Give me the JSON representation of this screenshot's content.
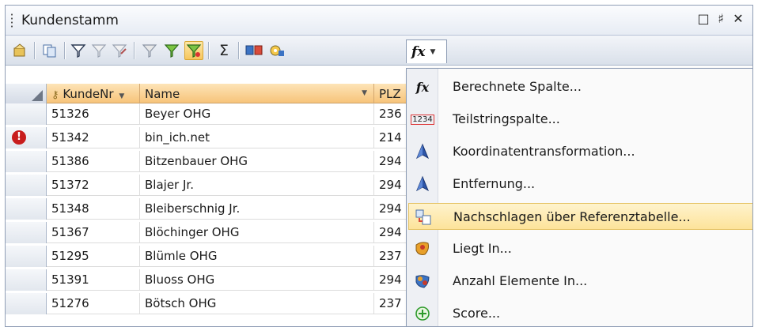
{
  "window": {
    "title": "Kundenstamm",
    "controls": {
      "pin": "□",
      "float": "♯",
      "close": "✕"
    }
  },
  "toolbar": {
    "fx_label": "fx",
    "buttons": [
      "properties-icon",
      "copy-icon",
      "filter-icon",
      "filter-clear-icon",
      "filter-edit-icon",
      "filter-remove-icon",
      "filter-add-icon",
      "filter-active-icon",
      "sum-icon",
      "table-icon",
      "settings-icon"
    ]
  },
  "grid": {
    "columns": [
      {
        "label": "KundeNr"
      },
      {
        "label": "Name"
      },
      {
        "label": "PLZ"
      }
    ],
    "rows": [
      {
        "kundenr": "51326",
        "name": "Beyer OHG",
        "plz": "236",
        "error": false
      },
      {
        "kundenr": "51342",
        "name": "bin_ich.net",
        "plz": "214",
        "error": true
      },
      {
        "kundenr": "51386",
        "name": "Bitzenbauer OHG",
        "plz": "294",
        "error": false
      },
      {
        "kundenr": "51372",
        "name": "Blajer Jr.",
        "plz": "294",
        "error": false
      },
      {
        "kundenr": "51348",
        "name": "Bleiberschnig Jr.",
        "plz": "294",
        "error": false
      },
      {
        "kundenr": "51367",
        "name": "Blöchinger OHG",
        "plz": "294",
        "error": false
      },
      {
        "kundenr": "51295",
        "name": "Blümle OHG",
        "plz": "237",
        "error": false
      },
      {
        "kundenr": "51391",
        "name": "Bluoss OHG",
        "plz": "294",
        "error": false
      },
      {
        "kundenr": "51276",
        "name": "Bötsch OHG",
        "plz": "237",
        "error": false
      }
    ],
    "error_glyph": "!"
  },
  "menu": {
    "items": [
      {
        "label": "Berechnete Spalte...",
        "icon": "fx-icon"
      },
      {
        "label": "Teilstringspalte...",
        "icon": "substring-icon",
        "icon_text": "1234"
      },
      {
        "label": "Koordinatentransformation...",
        "icon": "triangle-icon"
      },
      {
        "label": "Entfernung...",
        "icon": "triangle-icon"
      },
      {
        "label": "Nachschlagen über Referenztabelle...",
        "icon": "lookup-icon"
      },
      {
        "label": "Liegt In...",
        "icon": "map-region-icon"
      },
      {
        "label": "Anzahl Elemente In...",
        "icon": "map-count-icon"
      },
      {
        "label": "Score...",
        "icon": "score-icon"
      }
    ],
    "highlighted_index": 4
  }
}
